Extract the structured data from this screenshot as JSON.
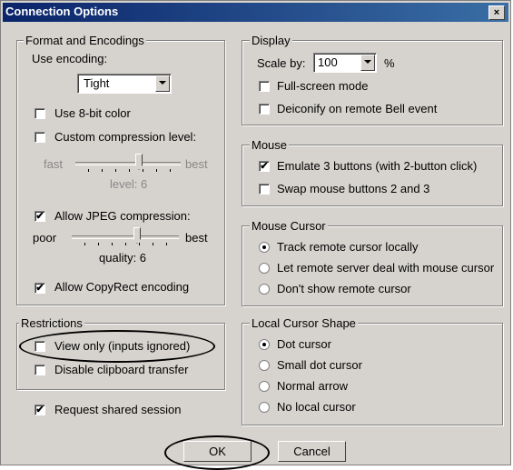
{
  "window": {
    "title": "Connection Options",
    "close_glyph": "×"
  },
  "format": {
    "group_title": "Format and Encodings",
    "use_encoding_label": "Use encoding:",
    "encoding_value": "Tight",
    "use_8bit": {
      "label": "Use 8-bit color",
      "checked": false
    },
    "custom_compression": {
      "label": "Custom compression level:",
      "checked": false
    },
    "compression_slider": {
      "left": "fast",
      "right": "best",
      "value_label": "level: 6",
      "value": 6,
      "enabled": false
    },
    "allow_jpeg": {
      "label": "Allow JPEG compression:",
      "checked": true
    },
    "quality_slider": {
      "left": "poor",
      "right": "best",
      "value_label": "quality: 6",
      "value": 6,
      "enabled": true
    },
    "copyrect": {
      "label": "Allow CopyRect encoding",
      "checked": true
    }
  },
  "restrictions": {
    "group_title": "Restrictions",
    "view_only": {
      "label": "View only (inputs ignored)",
      "checked": false
    },
    "disable_clipboard": {
      "label": "Disable clipboard transfer",
      "checked": false
    }
  },
  "shared": {
    "label": "Request shared session",
    "checked": true
  },
  "display": {
    "group_title": "Display",
    "scale_label": "Scale by:",
    "scale_value": "100",
    "scale_unit": "%",
    "fullscreen": {
      "label": "Full-screen mode",
      "checked": false
    },
    "deiconify": {
      "label": "Deiconify on remote Bell event",
      "checked": false
    }
  },
  "mouse": {
    "group_title": "Mouse",
    "emulate3": {
      "label": "Emulate 3 buttons (with 2-button click)",
      "checked": true
    },
    "swap": {
      "label": "Swap mouse buttons 2 and 3",
      "checked": false
    }
  },
  "mouse_cursor": {
    "group_title": "Mouse Cursor",
    "options": [
      "Track remote cursor locally",
      "Let remote server deal with mouse cursor",
      "Don't show remote cursor"
    ],
    "selected": 0
  },
  "local_cursor": {
    "group_title": "Local Cursor Shape",
    "options": [
      "Dot cursor",
      "Small dot cursor",
      "Normal arrow",
      "No local cursor"
    ],
    "selected": 0
  },
  "buttons": {
    "ok": "OK",
    "cancel": "Cancel"
  },
  "check_glyph": "✔"
}
